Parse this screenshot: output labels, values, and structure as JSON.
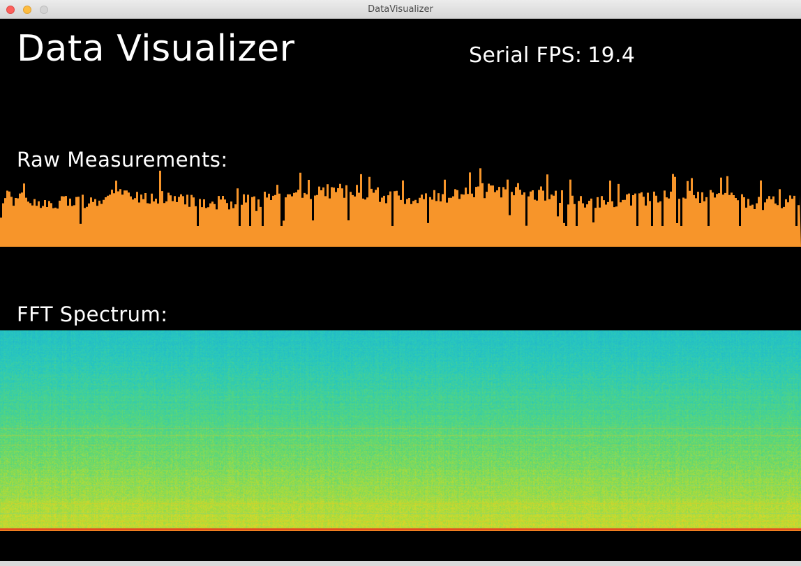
{
  "window": {
    "title": "DataVisualizer"
  },
  "app": {
    "title": "Data Visualizer",
    "fps_label": "Serial FPS:",
    "fps_value": "19.4"
  },
  "raw": {
    "label": "Raw Measurements:",
    "fill_color": "#f7952a"
  },
  "fft": {
    "label": "FFT Spectrum:",
    "colormap": "viridis-like (teal → green → yellow → red)"
  }
}
